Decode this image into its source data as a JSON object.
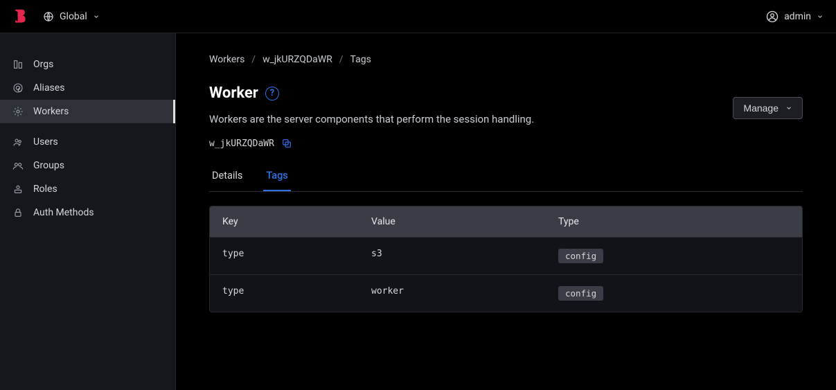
{
  "header": {
    "scope_label": "Global",
    "user_label": "admin"
  },
  "sidebar": {
    "items": [
      {
        "icon": "org",
        "label": "Orgs"
      },
      {
        "icon": "alias",
        "label": "Aliases"
      },
      {
        "icon": "worker",
        "label": "Workers"
      },
      {
        "icon": "users",
        "label": "Users"
      },
      {
        "icon": "groups",
        "label": "Groups"
      },
      {
        "icon": "roles",
        "label": "Roles"
      },
      {
        "icon": "auth",
        "label": "Auth Methods"
      }
    ],
    "active_index": 2,
    "sep_after_index": 2
  },
  "breadcrumbs": [
    "Workers",
    "w_jkURZQDaWR",
    "Tags"
  ],
  "page": {
    "title": "Worker",
    "subtitle": "Workers are the server components that perform the session handling.",
    "resource_id": "w_jkURZQDaWR",
    "manage_label": "Manage"
  },
  "tabs": [
    {
      "label": "Details",
      "active": false
    },
    {
      "label": "Tags",
      "active": true
    }
  ],
  "table": {
    "headers": [
      "Key",
      "Value",
      "Type",
      ""
    ],
    "rows": [
      {
        "key": "type",
        "value": "s3",
        "type": "config"
      },
      {
        "key": "type",
        "value": "worker",
        "type": "config"
      }
    ]
  }
}
